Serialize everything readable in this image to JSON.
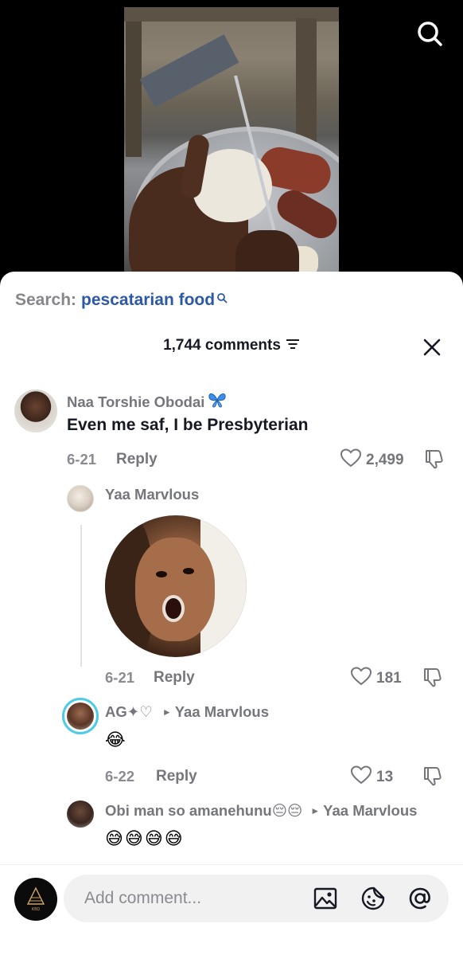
{
  "search": {
    "prefix": "Search:",
    "term": "pescatarian food"
  },
  "header": {
    "comment_count": "1,744 comments"
  },
  "comments": [
    {
      "username": "Naa Torshie Obodai",
      "badge_icon": "butterfly-icon",
      "text": "Even me saf, I be Presbyterian",
      "date": "6-21",
      "reply_label": "Reply",
      "likes": "2,499"
    },
    {
      "username": "Yaa Marvlous",
      "media": "reaction-gif",
      "date": "6-21",
      "reply_label": "Reply",
      "likes": "181"
    },
    {
      "username": "AG✦♡",
      "reply_to": "Yaa Marvlous",
      "text": "😂",
      "date": "6-22",
      "reply_label": "Reply",
      "likes": "13"
    },
    {
      "username": "Obi man so amanehunu😔😔",
      "reply_to": "Yaa Marvlous",
      "text": "😅😅😅😅"
    }
  ],
  "composer": {
    "placeholder": "Add comment...",
    "avatar_text": "KBD"
  },
  "colors": {
    "accent_link": "#2d58a7",
    "muted": "#75767b",
    "text": "#161823"
  }
}
